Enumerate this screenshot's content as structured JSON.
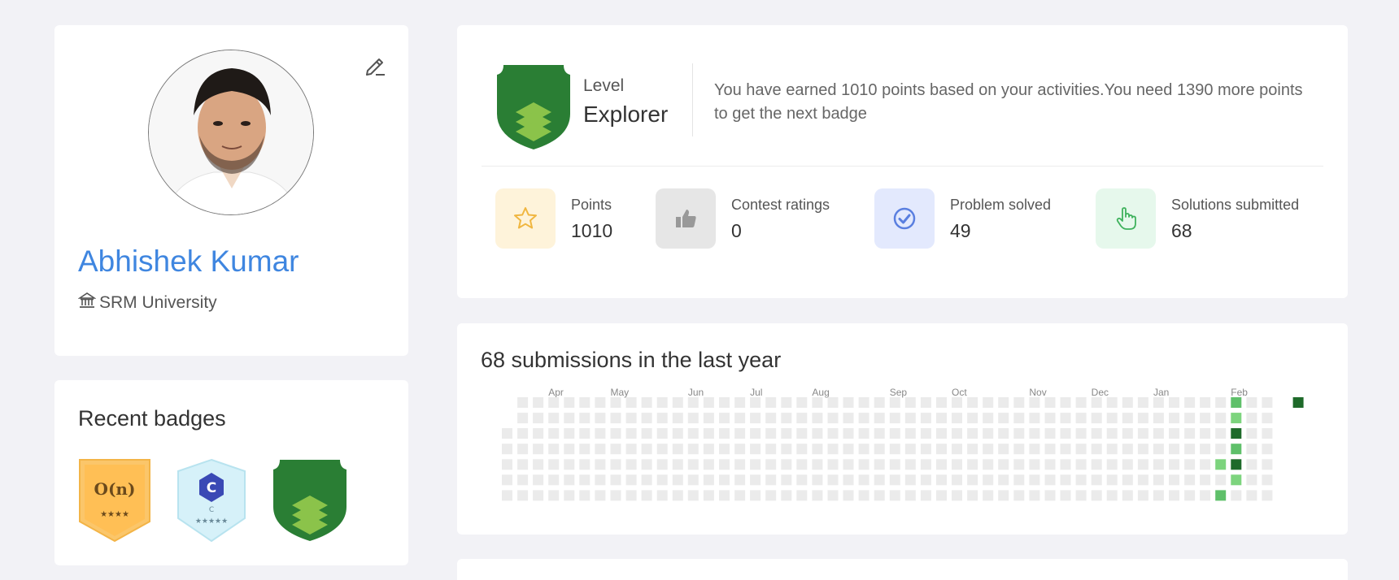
{
  "profile": {
    "name": "Abhishek Kumar",
    "institution": "SRM University"
  },
  "badges": {
    "title": "Recent badges",
    "items": [
      {
        "name": "O(n)",
        "stars": "★★★★",
        "color": "#f7bd4f"
      },
      {
        "name": "C",
        "sub": "C",
        "stars": "★★★★★",
        "color": "#cdeef7"
      },
      {
        "name": "Explorer",
        "color": "#2a7e34"
      }
    ]
  },
  "level": {
    "caption": "Level",
    "name": "Explorer",
    "message": "You have earned 1010 points based on your activities.You need 1390 more points to get the next badge"
  },
  "stats": [
    {
      "label": "Points",
      "value": "1010",
      "icon": "star-icon",
      "bg": "#fef3da",
      "fg": "#f0b640"
    },
    {
      "label": "Contest ratings",
      "value": "0",
      "icon": "thumbs-up-icon",
      "bg": "#e6e6e6",
      "fg": "#999999"
    },
    {
      "label": "Problem solved",
      "value": "49",
      "icon": "check-circle-icon",
      "bg": "#e3e9fd",
      "fg": "#5a7fe0"
    },
    {
      "label": "Solutions submitted",
      "value": "68",
      "icon": "pointer-hand-icon",
      "bg": "#e6f8ec",
      "fg": "#3fb25d"
    }
  ],
  "submissions": {
    "title": "68 submissions in the last year",
    "months": [
      "Apr",
      "May",
      "Jun",
      "Jul",
      "Aug",
      "Sep",
      "Oct",
      "Nov",
      "Dec",
      "Jan",
      "Feb"
    ],
    "colors": {
      "empty": "#ebebeb",
      "low": "#7dd47e",
      "mid": "#5fc06a",
      "high": "#1e6a2a"
    }
  }
}
